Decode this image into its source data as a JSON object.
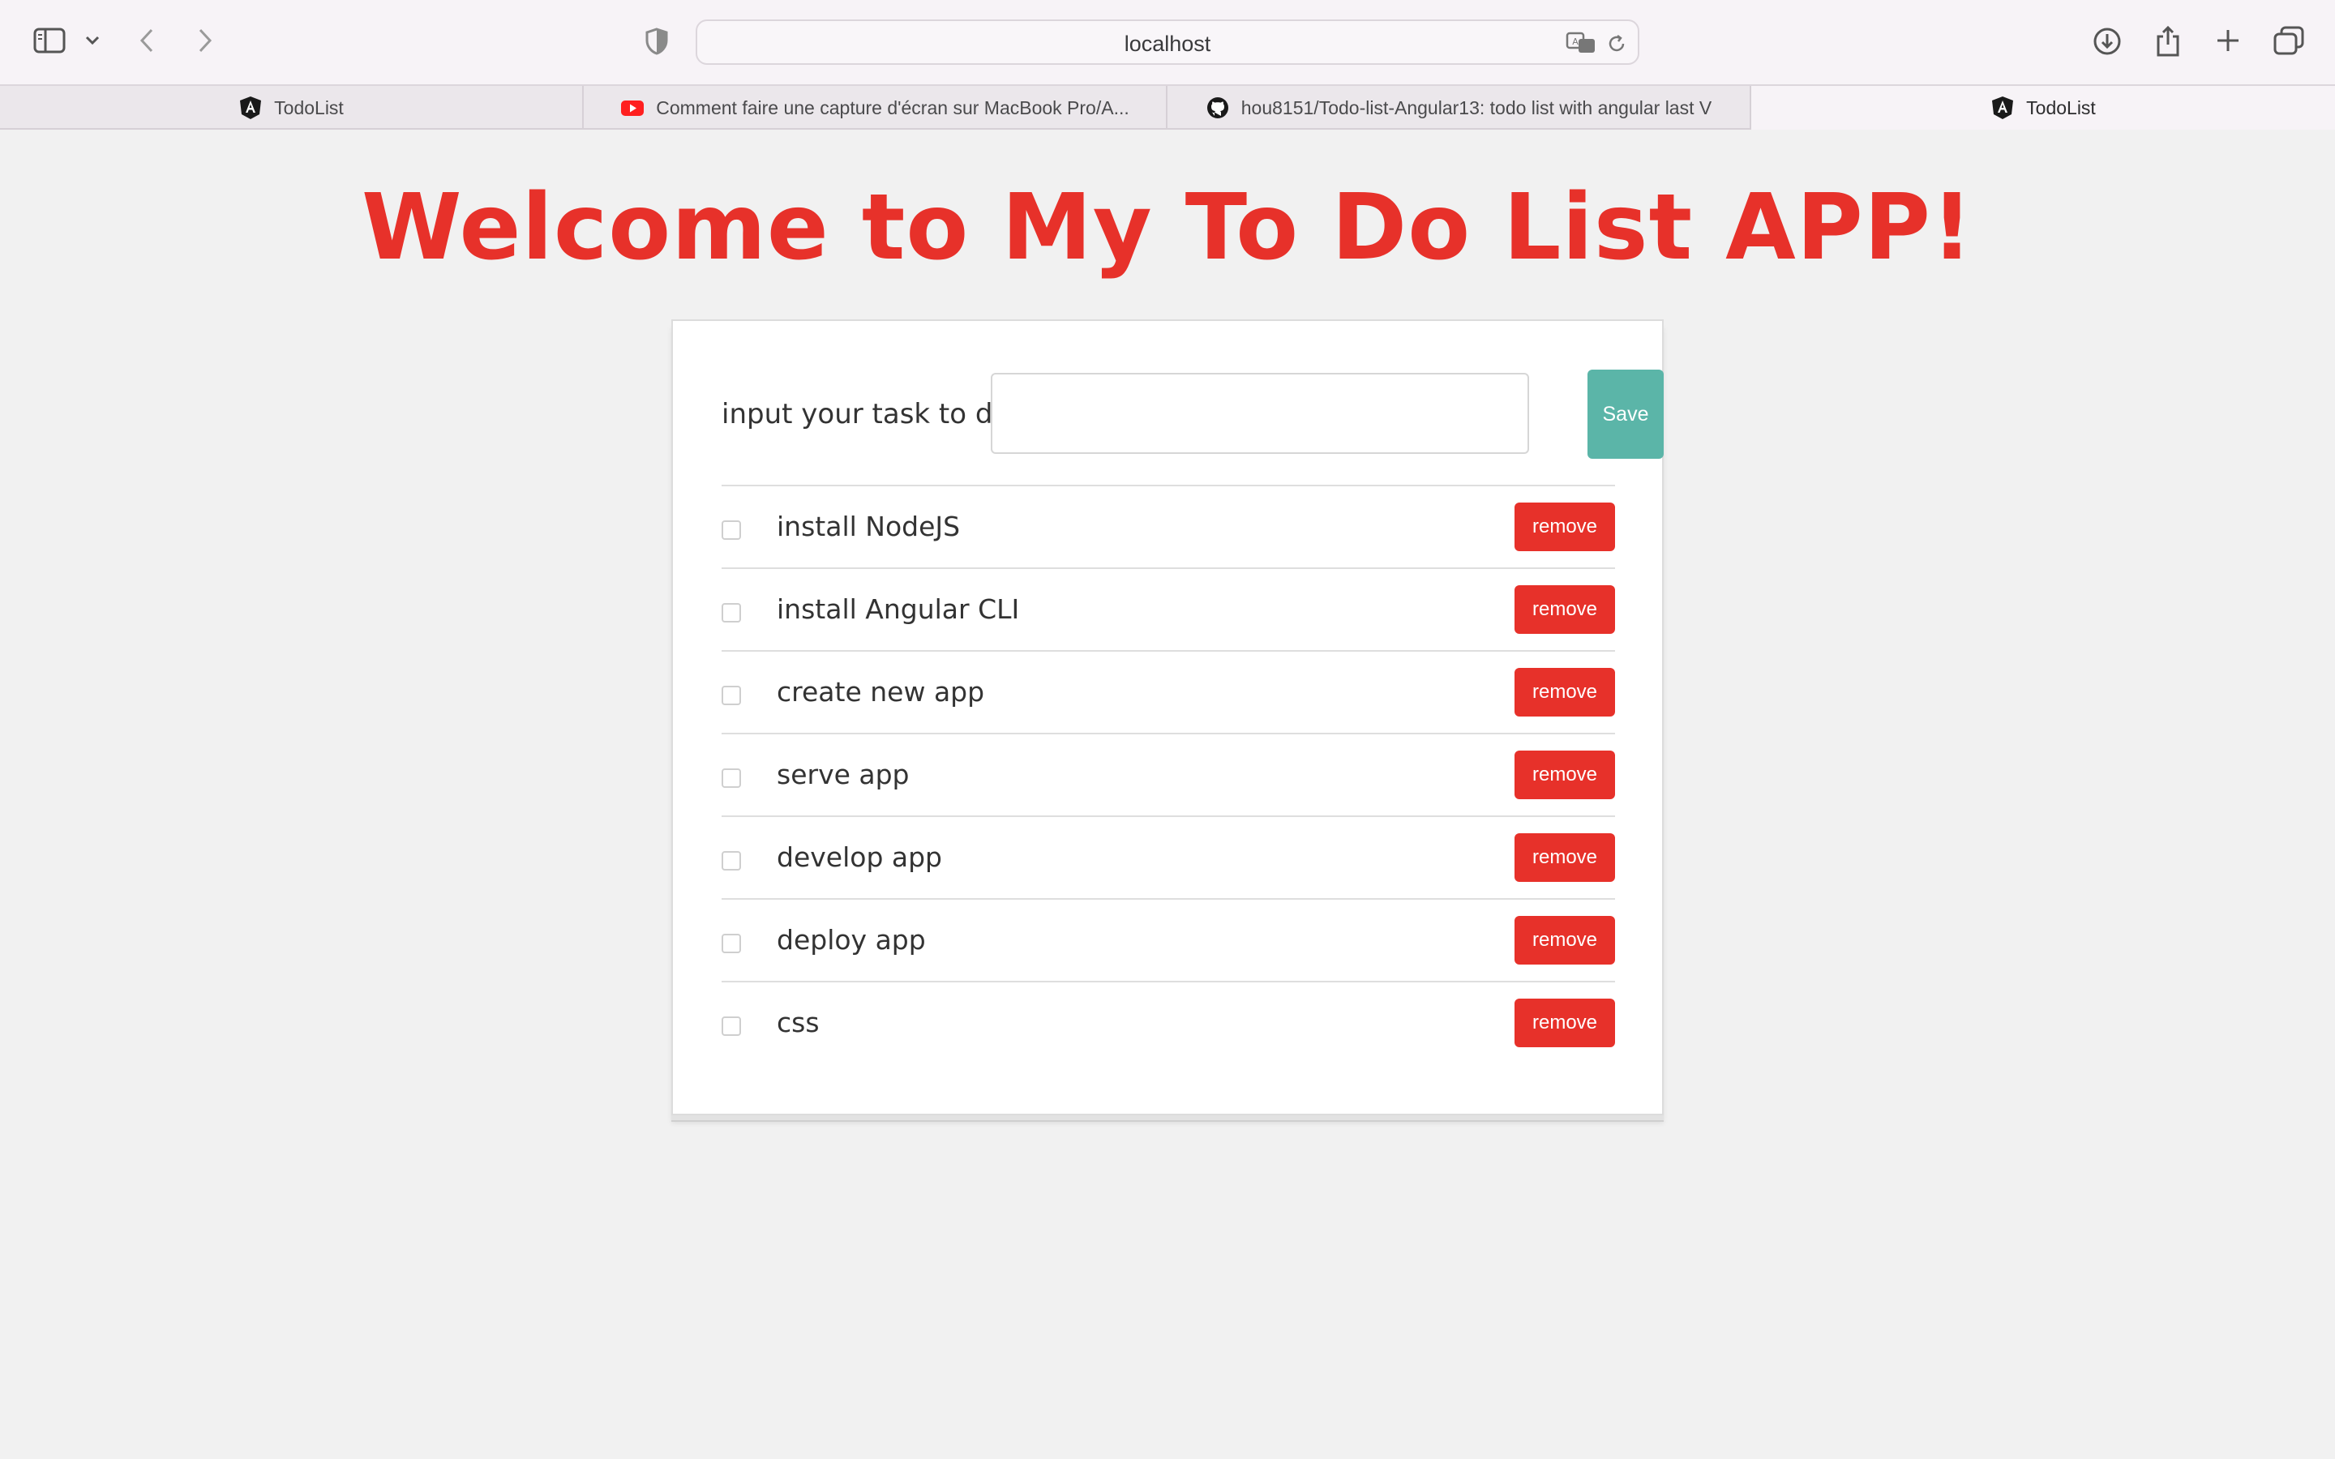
{
  "browser": {
    "url": "localhost",
    "tabs": [
      {
        "label": "TodoList",
        "icon": "angular-icon"
      },
      {
        "label": "Comment faire une capture d'écran sur MacBook Pro/A...",
        "icon": "youtube-icon"
      },
      {
        "label": "hou8151/Todo-list-Angular13: todo list with angular last V",
        "icon": "github-icon"
      },
      {
        "label": "TodoList",
        "icon": "angular-icon",
        "active": true
      }
    ]
  },
  "app": {
    "title": "Welcome to My To Do List APP!",
    "input_label": "input your task to do",
    "input_value": "",
    "save_label": "Save",
    "remove_label": "remove",
    "todos": [
      {
        "text": "install NodeJS",
        "done": false
      },
      {
        "text": "install Angular CLI",
        "done": false
      },
      {
        "text": "create new app",
        "done": false
      },
      {
        "text": "serve app",
        "done": false
      },
      {
        "text": "develop app",
        "done": false
      },
      {
        "text": "deploy app",
        "done": false
      },
      {
        "text": "css",
        "done": false
      }
    ]
  },
  "colors": {
    "accent_red": "#e7312a",
    "save_teal": "#5bb5a8",
    "page_bg": "#f1f1f1"
  }
}
